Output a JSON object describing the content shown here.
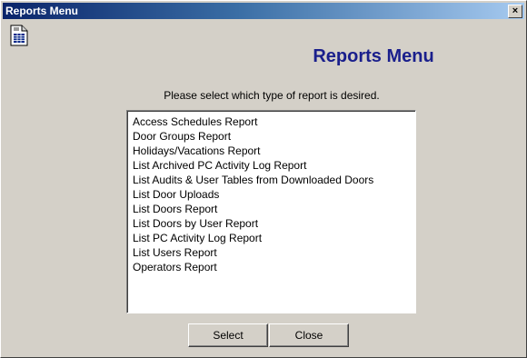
{
  "window": {
    "title": "Reports Menu",
    "close_glyph": "×",
    "colors": {
      "title_start": "#0a246a",
      "title_end": "#a6caf0",
      "heading": "#1a1f8c",
      "face": "#d4d0c8"
    }
  },
  "header": {
    "icon": "report-document-icon",
    "title": "Reports Menu"
  },
  "main": {
    "prompt": "Please select which type of report is desired.",
    "reports": [
      "Access Schedules Report",
      "Door Groups Report",
      "Holidays/Vacations Report",
      "List Archived PC Activity Log Report",
      "List Audits & User Tables from Downloaded Doors",
      "List Door Uploads",
      "List Doors Report",
      "List Doors by User Report",
      "List PC Activity Log Report",
      "List Users Report",
      "Operators Report"
    ]
  },
  "buttons": {
    "select_label": "Select",
    "close_label": "Close"
  }
}
